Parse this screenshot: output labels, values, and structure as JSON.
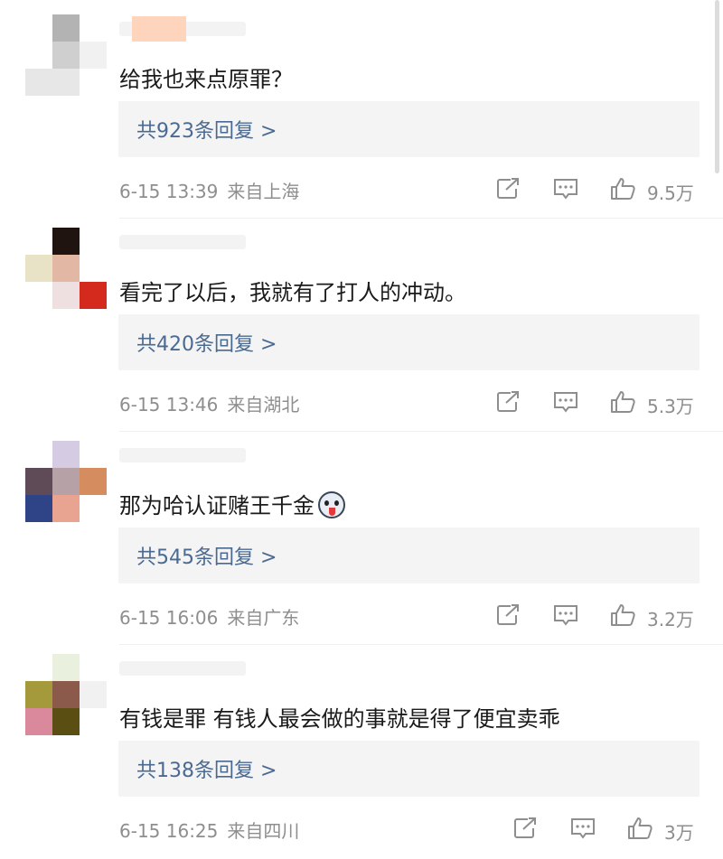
{
  "comments": [
    {
      "text": "给我也来点原罪？",
      "reply_label": "共923条回复 >",
      "date": "6-15 13:39",
      "location": "来自上海",
      "likes": "9.5万",
      "avatar_colors": [
        "#ffffff",
        "#b3b3b3",
        "#ffffff",
        "#ffffff",
        "#cfcfcf",
        "#f1f1f1",
        "#e7e7e7",
        "#e7e7e7",
        "#ffffff"
      ]
    },
    {
      "text": "看完了以后，我就有了打人的冲动。",
      "reply_label": "共420条回复 >",
      "date": "6-15 13:46",
      "location": "来自湖北",
      "likes": "5.3万",
      "avatar_colors": [
        "#ffffff",
        "#1f1410",
        "#ffffff",
        "#e8e3c6",
        "#e2b7a3",
        "#ffffff",
        "#ffffff",
        "#eee0e0",
        "#d42a1d"
      ]
    },
    {
      "text": "那为哈认证赌王千金",
      "reply_label": "共545条回复 >",
      "date": "6-15 16:06",
      "location": "来自广东",
      "likes": "3.2万",
      "avatar_colors": [
        "#ffffff",
        "#d5cbe2",
        "#ffffff",
        "#5f4b57",
        "#b6a2a6",
        "#d58d60",
        "#2f4486",
        "#e8a491",
        "#ffffff"
      ]
    },
    {
      "text": "有钱是罪 有钱人最会做的事就是得了便宜卖乖",
      "reply_label": "共138条回复 >",
      "date": "6-15 16:25",
      "location": "来自四川",
      "likes": "3万",
      "avatar_colors": [
        "#ffffff",
        "#e9f1de",
        "#ffffff",
        "#a59a3b",
        "#8b5a4b",
        "#f1f1f1",
        "#d9899b",
        "#5a4e12",
        "#ffffff"
      ]
    }
  ],
  "icons": {
    "share": "share-icon",
    "comment": "comment-icon",
    "like": "like-icon",
    "emoji": "dog-emoji-icon"
  },
  "colors": {
    "reply_link": "#4b6a92",
    "meta": "#8e8e8e",
    "reply_bg": "#f4f4f4"
  }
}
